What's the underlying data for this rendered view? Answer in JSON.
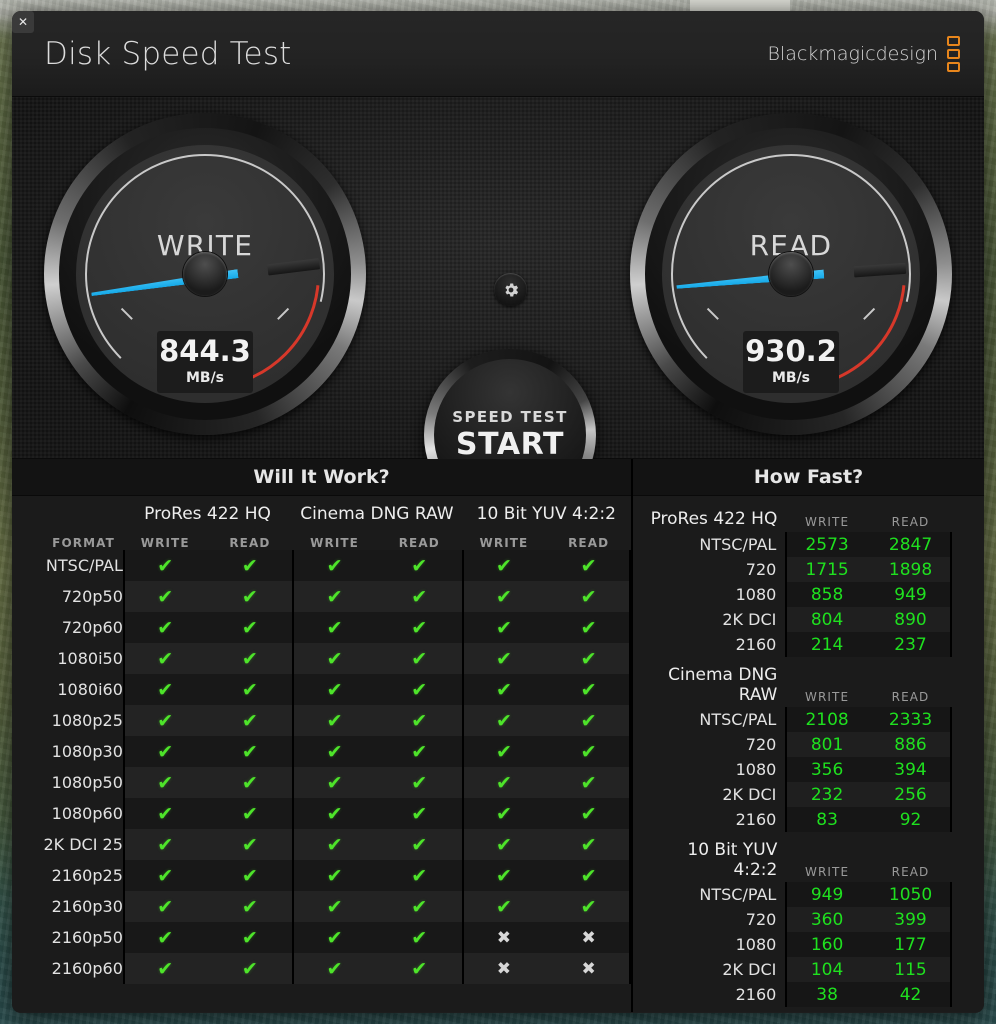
{
  "window": {
    "close_label": "✕",
    "title": "Disk Speed Test",
    "brand": "Blackmagicdesign"
  },
  "gauges": {
    "write": {
      "label": "WRITE",
      "value": "844.3",
      "unit": "MB/s",
      "needle_angle": -7
    },
    "read": {
      "label": "READ",
      "value": "930.2",
      "unit": "MB/s",
      "needle_angle": -4
    },
    "gear_icon": "gear-icon",
    "start_button": {
      "top_label": "SPEED TEST",
      "main_label": "START"
    }
  },
  "will_it_work": {
    "title": "Will It Work?",
    "format_header": "FORMAT",
    "groups": [
      {
        "name": "ProRes 422 HQ",
        "sub": [
          "WRITE",
          "READ"
        ]
      },
      {
        "name": "Cinema DNG RAW",
        "sub": [
          "WRITE",
          "READ"
        ]
      },
      {
        "name": "10 Bit YUV 4:2:2",
        "sub": [
          "WRITE",
          "READ"
        ]
      }
    ],
    "yes_glyph": "✔",
    "no_glyph": "✖",
    "rows": [
      {
        "format": "NTSC/PAL",
        "marks": [
          "yes",
          "yes",
          "yes",
          "yes",
          "yes",
          "yes"
        ]
      },
      {
        "format": "720p50",
        "marks": [
          "yes",
          "yes",
          "yes",
          "yes",
          "yes",
          "yes"
        ]
      },
      {
        "format": "720p60",
        "marks": [
          "yes",
          "yes",
          "yes",
          "yes",
          "yes",
          "yes"
        ]
      },
      {
        "format": "1080i50",
        "marks": [
          "yes",
          "yes",
          "yes",
          "yes",
          "yes",
          "yes"
        ]
      },
      {
        "format": "1080i60",
        "marks": [
          "yes",
          "yes",
          "yes",
          "yes",
          "yes",
          "yes"
        ]
      },
      {
        "format": "1080p25",
        "marks": [
          "yes",
          "yes",
          "yes",
          "yes",
          "yes",
          "yes"
        ]
      },
      {
        "format": "1080p30",
        "marks": [
          "yes",
          "yes",
          "yes",
          "yes",
          "yes",
          "yes"
        ]
      },
      {
        "format": "1080p50",
        "marks": [
          "yes",
          "yes",
          "yes",
          "yes",
          "yes",
          "yes"
        ]
      },
      {
        "format": "1080p60",
        "marks": [
          "yes",
          "yes",
          "yes",
          "yes",
          "yes",
          "yes"
        ]
      },
      {
        "format": "2K DCI 25",
        "marks": [
          "yes",
          "yes",
          "yes",
          "yes",
          "yes",
          "yes"
        ]
      },
      {
        "format": "2160p25",
        "marks": [
          "yes",
          "yes",
          "yes",
          "yes",
          "yes",
          "yes"
        ]
      },
      {
        "format": "2160p30",
        "marks": [
          "yes",
          "yes",
          "yes",
          "yes",
          "yes",
          "yes"
        ]
      },
      {
        "format": "2160p50",
        "marks": [
          "yes",
          "yes",
          "yes",
          "yes",
          "no",
          "no"
        ]
      },
      {
        "format": "2160p60",
        "marks": [
          "yes",
          "yes",
          "yes",
          "yes",
          "no",
          "no"
        ]
      }
    ]
  },
  "how_fast": {
    "title": "How Fast?",
    "col_write": "WRITE",
    "col_read": "READ",
    "sections": [
      {
        "name": "ProRes 422 HQ",
        "rows": [
          {
            "res": "NTSC/PAL",
            "write": "2573",
            "read": "2847"
          },
          {
            "res": "720",
            "write": "1715",
            "read": "1898"
          },
          {
            "res": "1080",
            "write": "858",
            "read": "949"
          },
          {
            "res": "2K DCI",
            "write": "804",
            "read": "890"
          },
          {
            "res": "2160",
            "write": "214",
            "read": "237"
          }
        ]
      },
      {
        "name": "Cinema DNG RAW",
        "rows": [
          {
            "res": "NTSC/PAL",
            "write": "2108",
            "read": "2333"
          },
          {
            "res": "720",
            "write": "801",
            "read": "886"
          },
          {
            "res": "1080",
            "write": "356",
            "read": "394"
          },
          {
            "res": "2K DCI",
            "write": "232",
            "read": "256"
          },
          {
            "res": "2160",
            "write": "83",
            "read": "92"
          }
        ]
      },
      {
        "name": "10 Bit YUV 4:2:2",
        "rows": [
          {
            "res": "NTSC/PAL",
            "write": "949",
            "read": "1050"
          },
          {
            "res": "720",
            "write": "360",
            "read": "399"
          },
          {
            "res": "1080",
            "write": "160",
            "read": "177"
          },
          {
            "res": "2K DCI",
            "write": "104",
            "read": "115"
          },
          {
            "res": "2160",
            "write": "38",
            "read": "42"
          }
        ]
      }
    ]
  },
  "colors": {
    "needle": "#15a9e8",
    "ok_green": "#4ee42a",
    "value_green": "#1fe01f",
    "brand_orange": "#e8861c",
    "redline": "#d7382a"
  }
}
